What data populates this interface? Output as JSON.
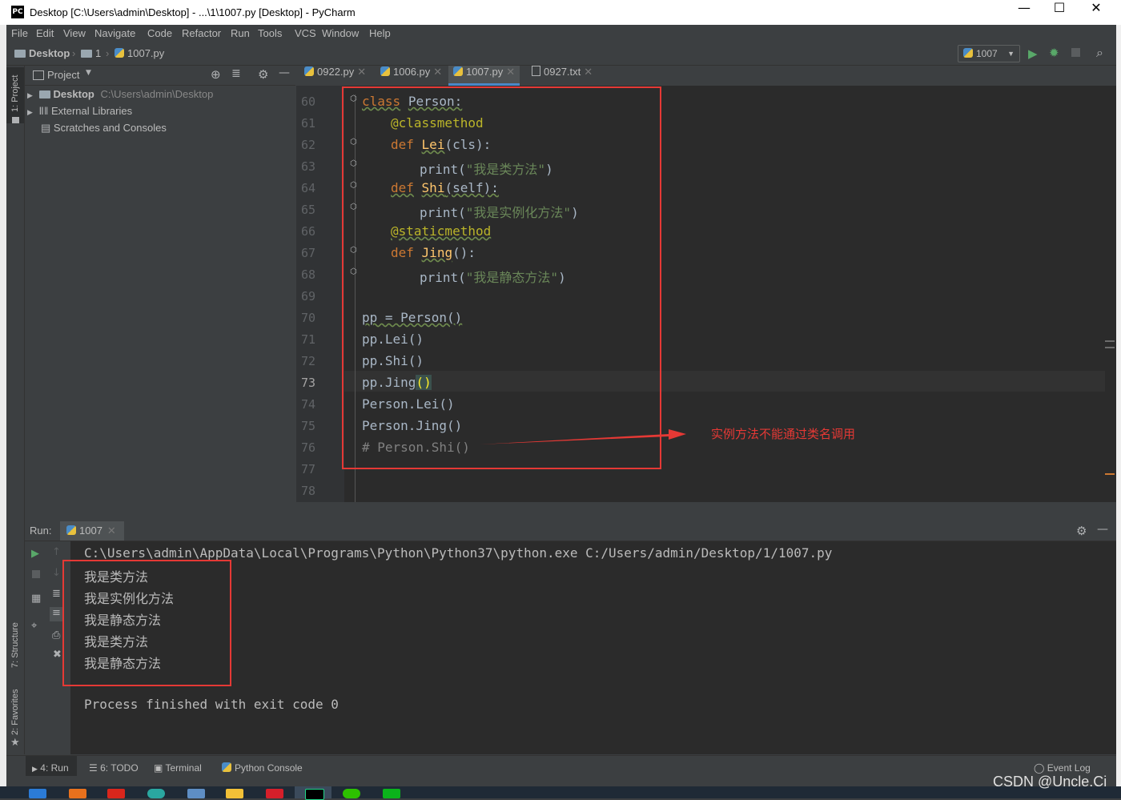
{
  "window": {
    "title": "Desktop [C:\\Users\\admin\\Desktop] - ...\\1\\1007.py [Desktop] - PyCharm",
    "app_icon": "PC"
  },
  "menu": [
    "File",
    "Edit",
    "View",
    "Navigate",
    "Code",
    "Refactor",
    "Run",
    "Tools",
    "VCS",
    "Window",
    "Help"
  ],
  "breadcrumb": [
    "Desktop",
    "1",
    "1007.py"
  ],
  "run_config": "1007",
  "project": {
    "header": "Project",
    "tree": [
      {
        "label": "Desktop",
        "path": "C:\\Users\\admin\\Desktop"
      },
      {
        "label": "External Libraries"
      },
      {
        "label": "Scratches and Consoles"
      }
    ]
  },
  "side_tabs": {
    "project": "1: Project",
    "structure": "7: Structure",
    "favorites": "2: Favorites"
  },
  "tabs": [
    {
      "label": "0922.py",
      "active": false
    },
    {
      "label": "1006.py",
      "active": false
    },
    {
      "label": "1007.py",
      "active": true
    },
    {
      "label": "0927.txt",
      "active": false
    }
  ],
  "editor": {
    "line_numbers": [
      "60",
      "61",
      "62",
      "63",
      "64",
      "65",
      "66",
      "67",
      "68",
      "69",
      "70",
      "71",
      "72",
      "73",
      "74",
      "75",
      "76",
      "77",
      "78"
    ],
    "current_line": "73"
  },
  "code": {
    "l60_kw": "class",
    "l60_name": "Person:",
    "l61": "@classmethod",
    "l62_kw": "def",
    "l62_fn": "Lei",
    "l62_args": "(cls):",
    "l63_call": "print(",
    "l63_str": "\"我是类方法\"",
    "l63_end": ")",
    "l64_kw": "def",
    "l64_fn": "Shi",
    "l64_args": "(self):",
    "l65_call": "print(",
    "l65_str": "\"我是实例化方法\"",
    "l65_end": ")",
    "l66": "@staticmethod",
    "l67_kw": "def",
    "l67_fn": "Jing",
    "l67_args": "():",
    "l68_call": "print(",
    "l68_str": "\"我是静态方法\"",
    "l68_end": ")",
    "l70": "pp = Person()",
    "l71": "pp.Lei()",
    "l72": "pp.Shi()",
    "l73": "pp.Jing",
    "l73_paren": "()",
    "l74": "Person.Lei()",
    "l75": "Person.Jing()",
    "l76": "# Person.Shi()"
  },
  "annotation": "实例方法不能通过类名调用",
  "run": {
    "label": "Run:",
    "tab": "1007",
    "command": "C:\\Users\\admin\\AppData\\Local\\Programs\\Python\\Python37\\python.exe C:/Users/admin/Desktop/1/1007.py",
    "output": [
      "我是类方法",
      "我是实例化方法",
      "我是静态方法",
      "我是类方法",
      "我是静态方法"
    ],
    "exit": "Process finished with exit code 0"
  },
  "bottom_tools": [
    "4: Run",
    "6: TODO",
    "Terminal",
    "Python Console"
  ],
  "event_log": "Event Log",
  "watermark": "CSDN @Uncle.Ci",
  "colors": {
    "accent": "#4a88c7",
    "annotation_red": "#e53935",
    "run_green": "#59a869"
  }
}
